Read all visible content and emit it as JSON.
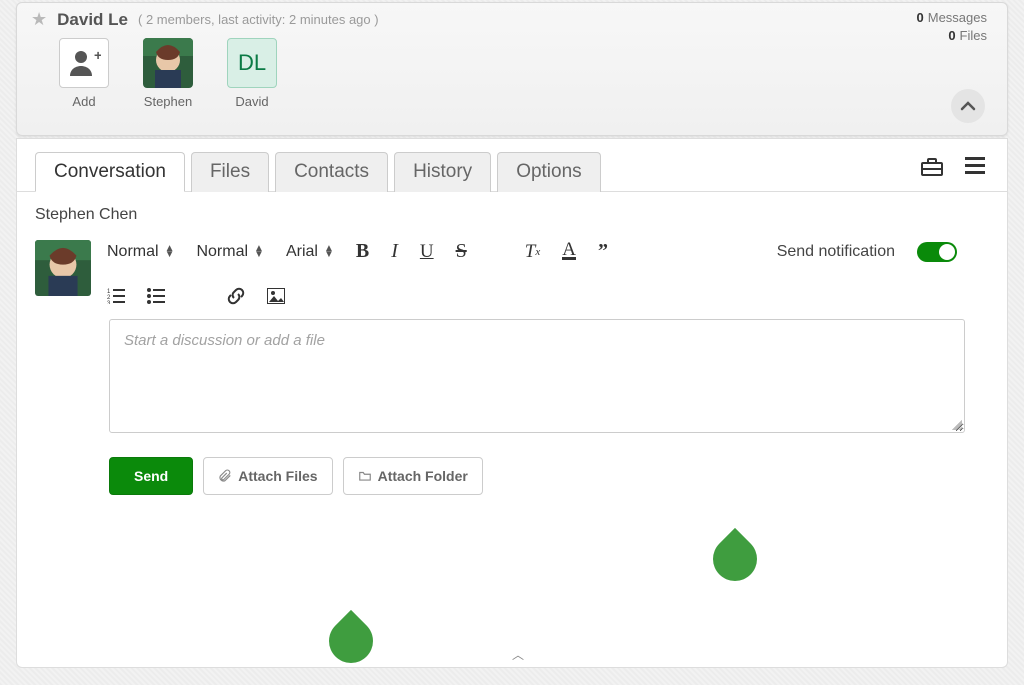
{
  "header": {
    "title": "David Le",
    "meta": "( 2 members, last activity: 2 minutes ago )",
    "messages_count": "0",
    "messages_label": "Messages",
    "files_count": "0",
    "files_label": "Files"
  },
  "members": {
    "add_label": "Add",
    "m1_name": "Stephen",
    "m2_name": "David",
    "m2_initials": "DL"
  },
  "tabs": {
    "t0": "Conversation",
    "t1": "Files",
    "t2": "Contacts",
    "t3": "History",
    "t4": "Options"
  },
  "composer": {
    "author": "Stephen Chen",
    "size": "Normal",
    "heading": "Normal",
    "font": "Arial",
    "placeholder": "Start a discussion or add a file",
    "notif_label": "Send notification"
  },
  "actions": {
    "send": "Send",
    "attach_files": "Attach Files",
    "attach_folder": "Attach Folder"
  }
}
